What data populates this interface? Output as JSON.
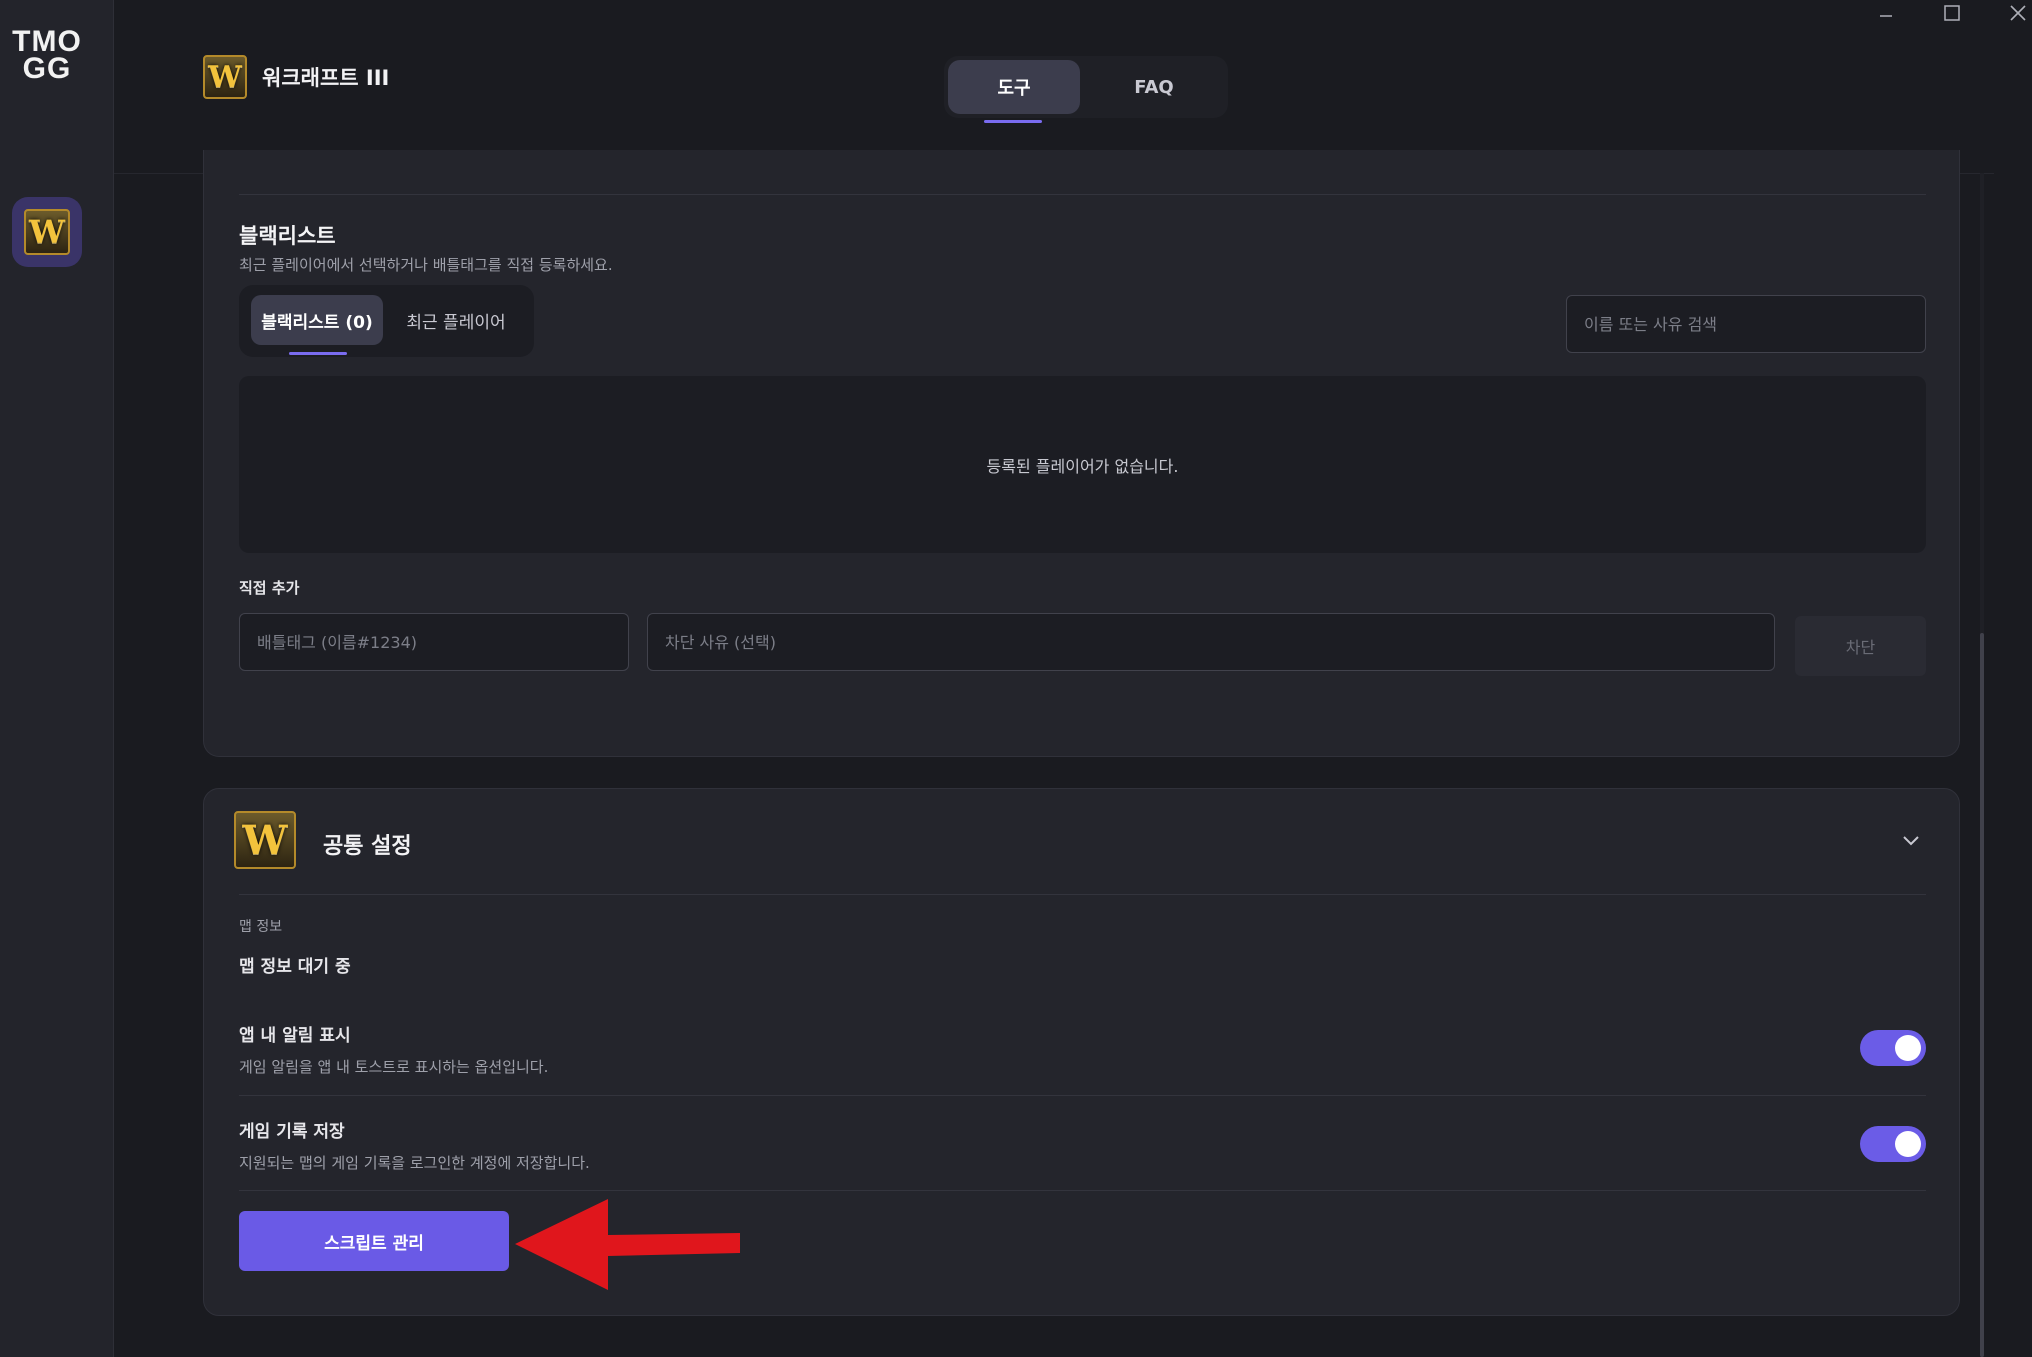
{
  "brand": {
    "logo_line1": "TMO",
    "logo_line2": "GG"
  },
  "sidebar": {
    "game_icon_letter": "W"
  },
  "window": {
    "minimize_glyph": "—",
    "maximize_glyph": "☐",
    "close_glyph": "✕"
  },
  "header": {
    "game_title": "워크래프트 III",
    "icon_letter": "W",
    "tabs": [
      {
        "label": "도구",
        "active": true
      },
      {
        "label": "FAQ",
        "active": false
      }
    ]
  },
  "blacklist": {
    "title": "블랙리스트",
    "subtitle": "최근 플레이어에서 선택하거나 배틀태그를 직접 등록하세요.",
    "tabs": [
      {
        "label": "블랙리스트 (0)",
        "active": true
      },
      {
        "label": "최근 플레이어",
        "active": false
      }
    ],
    "search_placeholder": "이름 또는 사유 검색",
    "empty_message": "등록된 플레이어가 없습니다.",
    "add_label": "직접 추가",
    "battletag_placeholder": "배틀태그 (이름#1234)",
    "reason_placeholder": "차단 사유 (선택)",
    "block_button": "차단"
  },
  "common_settings": {
    "title": "공통 설정",
    "icon_letter": "W",
    "map_info_label": "맵 정보",
    "map_info_value": "맵 정보 대기 중",
    "options": [
      {
        "title": "앱 내 알림 표시",
        "desc": "게임 알림을 앱 내 토스트로 표시하는 옵션입니다.",
        "enabled": true
      },
      {
        "title": "게임 기록 저장",
        "desc": "지원되는 맵의 게임 기록을 로그인한 계정에 저장합니다.",
        "enabled": true
      }
    ],
    "script_button": "스크립트 관리"
  },
  "colors": {
    "accent": "#6a5ae6",
    "annotation_arrow": "#e0161c"
  }
}
